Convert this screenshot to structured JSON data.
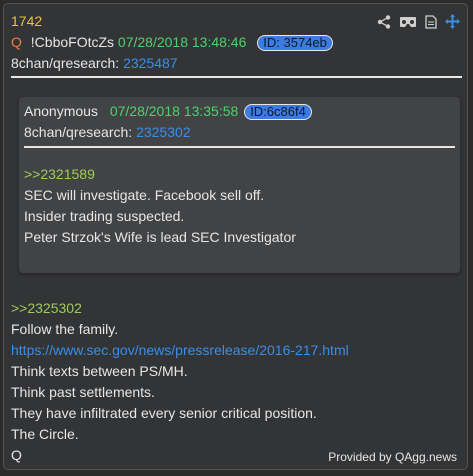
{
  "post": {
    "number": "1742",
    "q_marker": "Q",
    "tripcode": "!CbboFOtcZs",
    "datetime": "07/28/2018 13:48:46",
    "id_label": "ID: 3574eb",
    "board_label": "8chan/qresearch:",
    "post_link": "2325487",
    "reply_ref": ">>2325302",
    "lines": [
      "Follow the family.",
      "https://www.sec.gov/news/pressrelease/2016-217.html",
      "Think texts between PS/MH.",
      "Think past settlements.",
      "They have infiltrated every senior critical position.",
      "The Circle.",
      "Q"
    ]
  },
  "quoted": {
    "author": "Anonymous",
    "datetime": "07/28/2018 13:35:58",
    "id_label": "ID:6c86f4",
    "board_label": "8chan/qresearch:",
    "post_link": "2325302",
    "reply_ref": ">>2321589",
    "lines": [
      "SEC will investigate. Facebook sell off.",
      "Insider trading suspected.",
      "Peter Strzok's Wife is lead SEC Investigator"
    ]
  },
  "toolbar": {
    "icons": [
      "share-icon",
      "vr-goggles-icon",
      "document-icon",
      "move-icon"
    ]
  },
  "footer": {
    "provided_by": "Provided by QAgg.news"
  },
  "colors": {
    "background": "#333436",
    "post_number": "#e8c24a",
    "datetime": "#4cd26b",
    "link": "#3b8ee8",
    "greentext": "#9fcc5a",
    "id_pill": "#3c7be0"
  }
}
